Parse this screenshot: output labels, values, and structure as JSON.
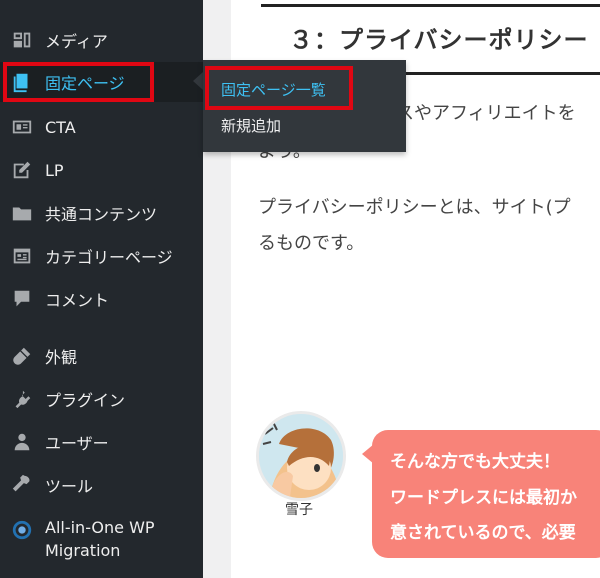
{
  "sidebar": {
    "items": [
      {
        "label": "メディア",
        "icon": "media-icon"
      },
      {
        "label": "固定ページ",
        "icon": "pages-icon"
      },
      {
        "label": "CTA",
        "icon": "cta-icon"
      },
      {
        "label": "LP",
        "icon": "lp-icon"
      },
      {
        "label": "共通コンテンツ",
        "icon": "folder-icon"
      },
      {
        "label": "カテゴリーページ",
        "icon": "category-page-icon"
      },
      {
        "label": "コメント",
        "icon": "comment-icon"
      },
      {
        "label": "外観",
        "icon": "appearance-icon"
      },
      {
        "label": "プラグイン",
        "icon": "plugin-icon"
      },
      {
        "label": "ユーザー",
        "icon": "user-icon"
      },
      {
        "label": "ツール",
        "icon": "tools-icon"
      },
      {
        "label": "All-in-One WP Migration",
        "icon": "migration-icon"
      }
    ]
  },
  "flyout": {
    "items": [
      {
        "label": "固定ページ一覧"
      },
      {
        "label": "新規追加"
      }
    ]
  },
  "content": {
    "heading": "３：プライバシーポリシー",
    "paragraphs": [
      "スやアフィリエイトを",
      "よう。",
      "プライバシーポリシーとは、サイト(プ",
      "るものです。"
    ],
    "avatar_name": "雪子",
    "bubble": [
      "そんな方でも大丈夫！",
      "ワードプレスには最初か",
      "意されているので、必要"
    ]
  },
  "colors": {
    "sidebar_bg": "#23282d",
    "flyout_bg": "#32373c",
    "accent": "#3ec1f3",
    "highlight_box": "#e00713",
    "bubble": "#f88379"
  }
}
